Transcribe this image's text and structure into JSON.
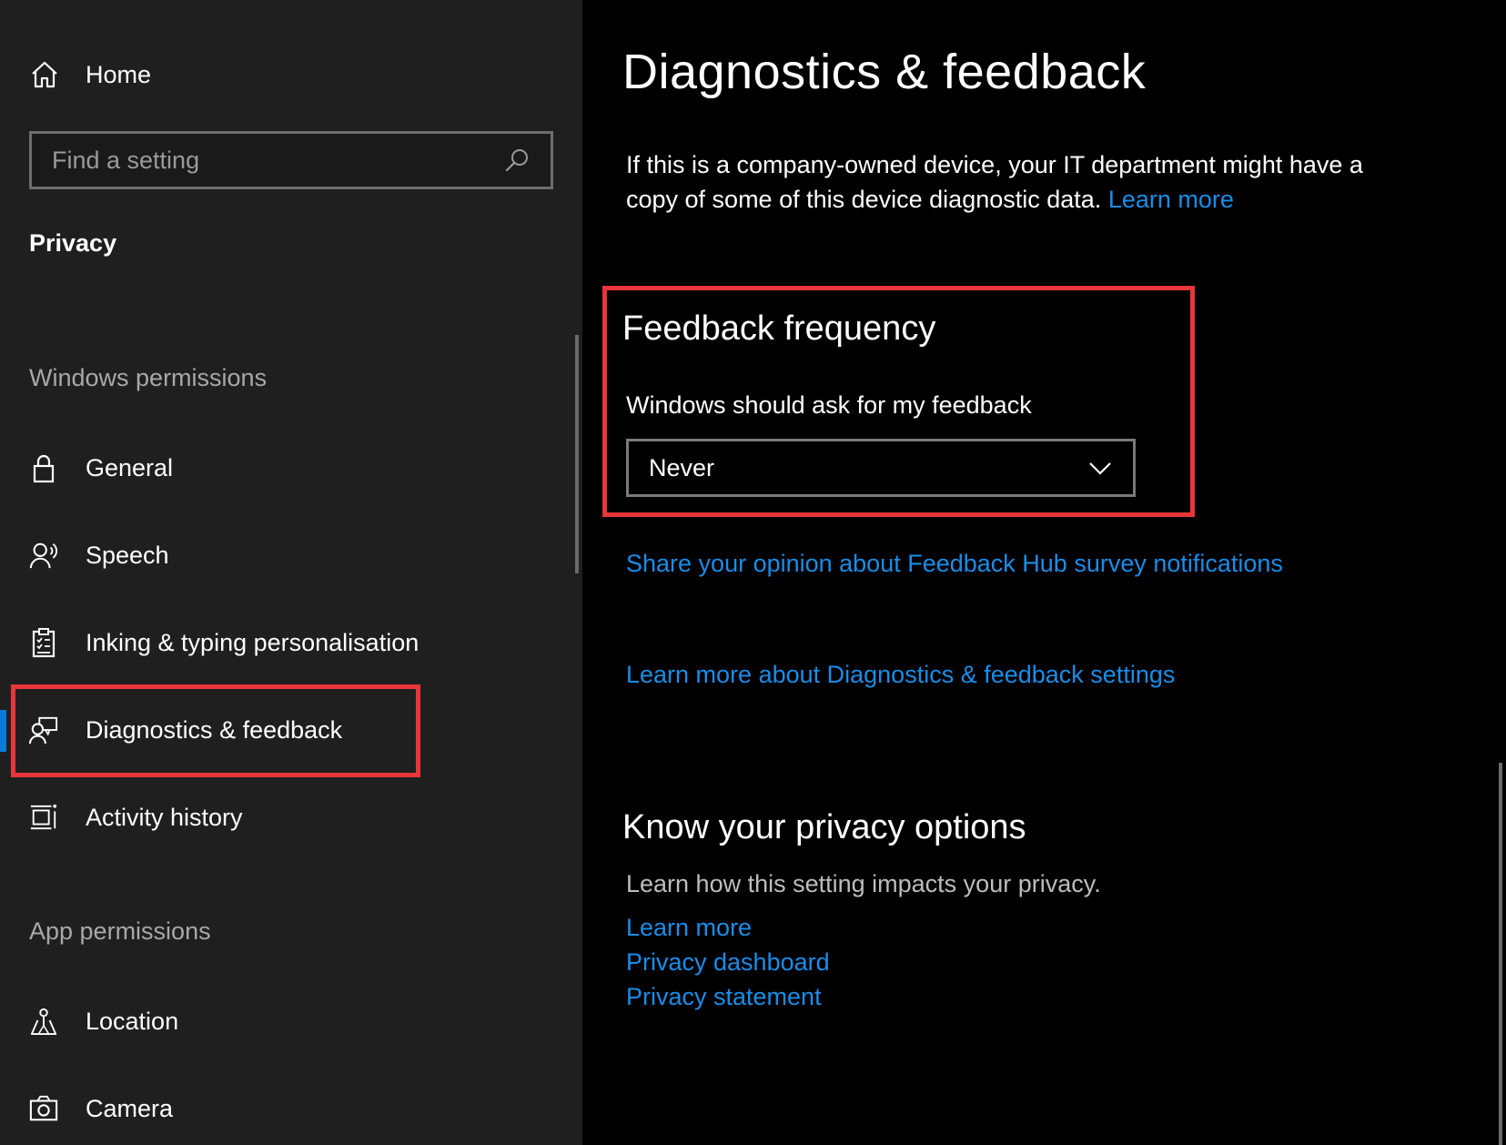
{
  "sidebar": {
    "home_label": "Home",
    "search_placeholder": "Find a setting",
    "section_title": "Privacy",
    "groups": {
      "windows_permissions": "Windows permissions",
      "app_permissions": "App permissions"
    },
    "items": [
      {
        "label": "General",
        "icon": "lock-icon"
      },
      {
        "label": "Speech",
        "icon": "speech-icon"
      },
      {
        "label": "Inking & typing personalisation",
        "icon": "clipboard-icon"
      },
      {
        "label": "Diagnostics & feedback",
        "icon": "feedback-icon",
        "selected": true
      },
      {
        "label": "Activity history",
        "icon": "activity-history-icon"
      },
      {
        "label": "Location",
        "icon": "location-icon"
      },
      {
        "label": "Camera",
        "icon": "camera-icon"
      }
    ]
  },
  "main": {
    "title": "Diagnostics & feedback",
    "intro_text": "If this is a company-owned device, your IT department might have a copy of some of this device diagnostic data.",
    "intro_link": "Learn more",
    "feedback_frequency": {
      "title": "Feedback frequency",
      "label": "Windows should ask for my feedback",
      "selected_value": "Never"
    },
    "share_opinion_link": "Share your opinion about Feedback Hub survey notifications",
    "learn_more_settings_link": "Learn more about Diagnostics & feedback settings",
    "privacy_options": {
      "title": "Know your privacy options",
      "description": "Learn how this setting impacts your privacy.",
      "links": [
        "Learn more",
        "Privacy dashboard",
        "Privacy statement"
      ]
    }
  },
  "colors": {
    "sidebar_bg": "#1f1f1f",
    "main_bg": "#000000",
    "link": "#1a8de8",
    "accent": "#0a7ad8",
    "highlight": "#e8363b"
  }
}
